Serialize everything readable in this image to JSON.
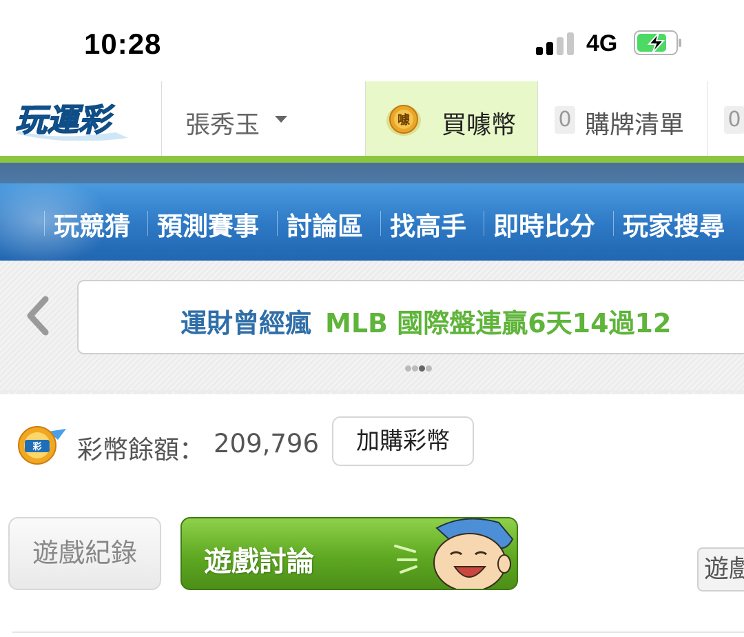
{
  "status_bar": {
    "time": "10:28",
    "network": "4G",
    "battery": "charging"
  },
  "header": {
    "logo_text": "玩運彩",
    "user_name": "張秀玉",
    "buy_coin_label": "買噱幣",
    "buy_coin_icon_text": "噱",
    "cart_count": "0",
    "cart_label": "購牌清單",
    "next_count": "0"
  },
  "nav": {
    "items": [
      "玩競猜",
      "預測賽事",
      "討論區",
      "找高手",
      "即時比分",
      "玩家搜尋"
    ]
  },
  "carousel": {
    "title_part1": "運財曾經瘋",
    "title_part2": "MLB 國際盤連贏6天14過12",
    "dots": 3,
    "active_dot": 2
  },
  "balance": {
    "label": "彩幣餘額：",
    "value": "209,796",
    "add_button": "加購彩幣"
  },
  "tabs": {
    "record": "遊戲紀錄",
    "discussion": "遊戲討論",
    "third": "遊戲"
  },
  "colors": {
    "nav_blue": "#2d78c4",
    "accent_green": "#8cc640",
    "banner_blue_text": "#2f6ea8",
    "banner_green_text": "#5fb43a",
    "buy_bg": "#e8f8c8"
  }
}
